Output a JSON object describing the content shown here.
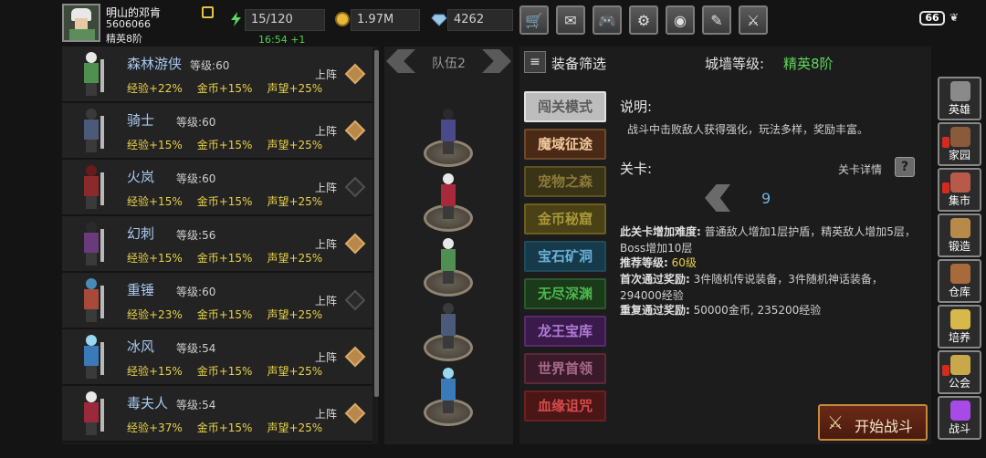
{
  "player": {
    "name": "明山的邓肯",
    "id": "5606066",
    "rank": "精英8阶",
    "avatar_icon": "player-portrait-icon",
    "edit_icon": "edit-icon"
  },
  "resources": {
    "energy": "15/120",
    "energy_icon": "lightning-icon",
    "gold": "1.97M",
    "gold_icon": "gold-coin-icon",
    "gems": "4262",
    "gem_icon": "diamond-icon",
    "timer": "16:54 +1"
  },
  "toolbar": {
    "buttons": [
      {
        "name": "shop",
        "icon": "cart-icon",
        "glyph": "🛒"
      },
      {
        "name": "mail",
        "icon": "mail-icon",
        "glyph": "✉"
      },
      {
        "name": "gamepad",
        "icon": "gamepad-icon",
        "glyph": "🎮"
      },
      {
        "name": "settings",
        "icon": "gear-icon",
        "glyph": "⚙"
      },
      {
        "name": "color",
        "icon": "color-wheel-icon",
        "glyph": "◉"
      },
      {
        "name": "feather",
        "icon": "feather-icon",
        "glyph": "✎"
      },
      {
        "name": "sword-alert",
        "icon": "crossed-swords-icon",
        "glyph": "⚔"
      }
    ]
  },
  "status": {
    "battery": "66",
    "leaf_icon": "leaf-icon",
    "leaf_glyph": "❦"
  },
  "heroes": [
    {
      "name": "森林游侠",
      "level_label": "等级",
      "level": "60",
      "exp": "经验+22%",
      "gold": "金币+15%",
      "rep": "声望+25%",
      "deploy": "上阵",
      "deployed": true,
      "color": "#4f8f4f",
      "hair": "#e8e8e8"
    },
    {
      "name": "骑士",
      "level_label": "等级",
      "level": "60",
      "exp": "经验+15%",
      "gold": "金币+15%",
      "rep": "声望+25%",
      "deploy": "上阵",
      "deployed": true,
      "color": "#4a5a78",
      "hair": "#3a3a3a"
    },
    {
      "name": "火岚",
      "level_label": "等级",
      "level": "60",
      "exp": "经验+15%",
      "gold": "金币+15%",
      "rep": "声望+25%",
      "deploy": "上阵",
      "deployed": false,
      "color": "#8a2a2a",
      "hair": "#6a1a1a"
    },
    {
      "name": "幻刺",
      "level_label": "等级",
      "level": "56",
      "exp": "经验+15%",
      "gold": "金币+15%",
      "rep": "声望+25%",
      "deploy": "上阵",
      "deployed": true,
      "color": "#6a3a7a",
      "hair": "#2a2a2a"
    },
    {
      "name": "重锤",
      "level_label": "等级",
      "level": "60",
      "exp": "经验+23%",
      "gold": "金币+15%",
      "rep": "声望+25%",
      "deploy": "上阵",
      "deployed": false,
      "color": "#a84a3a",
      "hair": "#4a8ab8"
    },
    {
      "name": "冰风",
      "level_label": "等级",
      "level": "54",
      "exp": "经验+15%",
      "gold": "金币+15%",
      "rep": "声望+25%",
      "deploy": "上阵",
      "deployed": true,
      "color": "#3a7ab8",
      "hair": "#9ad8f0"
    },
    {
      "name": "毒夫人",
      "level_label": "等级",
      "level": "54",
      "exp": "经验+37%",
      "gold": "金币+15%",
      "rep": "声望+25%",
      "deploy": "上阵",
      "deployed": true,
      "color": "#9a2a3a",
      "hair": "#e8e8e8"
    }
  ],
  "team": {
    "label": "队伍2",
    "members": [
      {
        "color": "#4a4a8a",
        "hair": "#2a2a2a"
      },
      {
        "color": "#a82a3a",
        "hair": "#e8e8e8"
      },
      {
        "color": "#4f8f4f",
        "hair": "#e8e8e8"
      },
      {
        "color": "#4a5a78",
        "hair": "#3a3a3a"
      },
      {
        "color": "#3a7ab8",
        "hair": "#9ad8f0"
      }
    ]
  },
  "panel": {
    "filter_label": "装备筛选",
    "wall_label": "城墙等级:",
    "wall_value": "精英8阶",
    "modes": [
      {
        "label": "闯关模式",
        "bg": "#bdbdbd",
        "fg": "#5a5a5a",
        "border": "#e0e0e0"
      },
      {
        "label": "魔域征途",
        "bg": "#4a2a16",
        "fg": "#f0c89a",
        "border": "#6a4a2a"
      },
      {
        "label": "宠物之森",
        "bg": "#3a3416",
        "fg": "#8a7a3a",
        "border": "#5a5020"
      },
      {
        "label": "金币秘窟",
        "bg": "#4a4216",
        "fg": "#a8983a",
        "border": "#6a6020"
      },
      {
        "label": "宝石矿洞",
        "bg": "#163a4a",
        "fg": "#6ab0d8",
        "border": "#204a5a"
      },
      {
        "label": "无尽深渊",
        "bg": "#1a3a1a",
        "fg": "#4cb84c",
        "border": "#2a5a2a"
      },
      {
        "label": "龙王宝库",
        "bg": "#3a1a4a",
        "fg": "#b07ad8",
        "border": "#5a2a6a"
      },
      {
        "label": "世界首领",
        "bg": "#3a1a2a",
        "fg": "#a86a8a",
        "border": "#5a2a3a"
      },
      {
        "label": "血缘诅咒",
        "bg": "#4a1616",
        "fg": "#d84a4a",
        "border": "#6a2020"
      }
    ],
    "desc_title": "说明:",
    "desc_text": "战斗中击败敌人获得强化，玩法多样，奖励丰富。",
    "level_title": "关卡:",
    "detail_label": "关卡详情",
    "detail_glyph": "?",
    "level_number": "9",
    "difficulty_label": "此关卡增加难度:",
    "difficulty_text": "普通敌人增加1层护盾，精英敌人增加5层，Boss增加10层",
    "recommend_label": "推荐等级:",
    "recommend_value": "60级",
    "first_reward_label": "首次通过奖励:",
    "first_reward_text": "3件随机传说装备，3件随机神话装备，294000经验",
    "repeat_reward_label": "重复通过奖励:",
    "repeat_reward_text": "50000金币, 235200经验",
    "start_label": "开始战斗",
    "start_icon": "crossed-swords-icon",
    "start_glyph": "⚔"
  },
  "sidebar": [
    {
      "label": "英雄",
      "icon": "helmet-icon",
      "color": "#8a8a8a",
      "alert": false
    },
    {
      "label": "家园",
      "icon": "house-icon",
      "color": "#8a5a3a",
      "alert": true
    },
    {
      "label": "集市",
      "icon": "market-icon",
      "color": "#b85a4a",
      "alert": true
    },
    {
      "label": "锻造",
      "icon": "anvil-icon",
      "color": "#b88a4a",
      "alert": false
    },
    {
      "label": "仓库",
      "icon": "chest-icon",
      "color": "#a86a3a",
      "alert": false
    },
    {
      "label": "培养",
      "icon": "training-icon",
      "color": "#d8b84a",
      "alert": false
    },
    {
      "label": "公会",
      "icon": "guild-icon",
      "color": "#c8a84a",
      "alert": true
    },
    {
      "label": "战斗",
      "icon": "portal-icon",
      "color": "#a84ae8",
      "alert": false
    }
  ]
}
